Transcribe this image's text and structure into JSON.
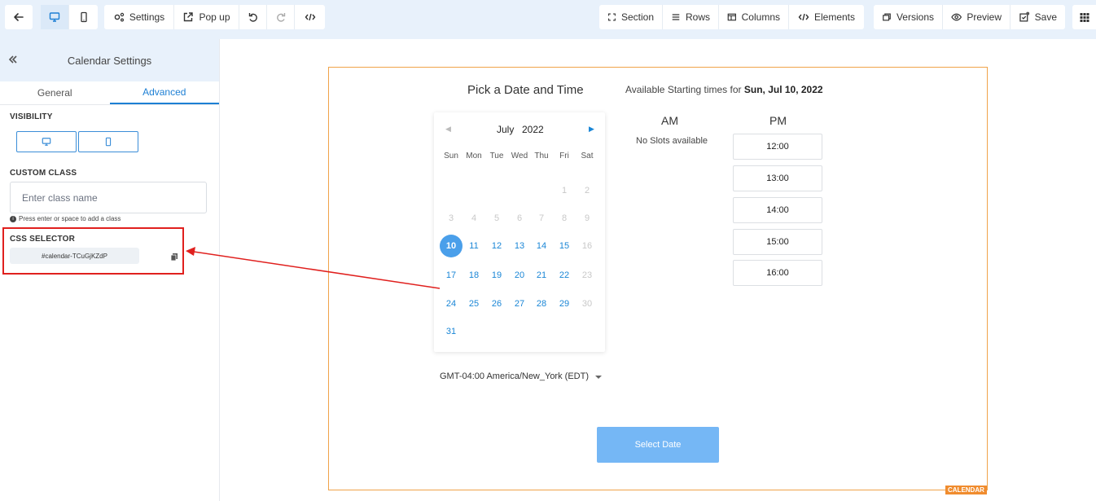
{
  "toolbar": {
    "settings_label": "Settings",
    "popup_label": "Pop up",
    "section_label": "Section",
    "rows_label": "Rows",
    "columns_label": "Columns",
    "elements_label": "Elements",
    "versions_label": "Versions",
    "preview_label": "Preview",
    "save_label": "Save"
  },
  "sidebar": {
    "title": "Calendar Settings",
    "tabs": [
      "General",
      "Advanced"
    ],
    "active_tab": "Advanced",
    "visibility_label": "VISIBILITY",
    "custom_class_label": "CUSTOM CLASS",
    "custom_class_placeholder": "Enter class name",
    "hint": "Press enter or space to add a class",
    "css_selector_label": "CSS SELECTOR",
    "css_selector_value": "#calendar-TCuGjKZdP"
  },
  "calendar": {
    "title": "Pick a Date and Time",
    "available_prefix": "Available Starting times for",
    "available_date": "Sun, Jul 10, 2022",
    "month": "July",
    "year": "2022",
    "weekdays": [
      "Sun",
      "Mon",
      "Tue",
      "Wed",
      "Thu",
      "Fri",
      "Sat"
    ],
    "weeks": [
      [
        "",
        "",
        "",
        "",
        "",
        "1",
        "2"
      ],
      [
        "3",
        "4",
        "5",
        "6",
        "7",
        "8",
        "9"
      ],
      [
        "10",
        "11",
        "12",
        "13",
        "14",
        "15",
        "16"
      ],
      [
        "17",
        "18",
        "19",
        "20",
        "21",
        "22",
        "23"
      ],
      [
        "24",
        "25",
        "26",
        "27",
        "28",
        "29",
        "30"
      ],
      [
        "31",
        "",
        "",
        "",
        "",
        "",
        ""
      ]
    ],
    "selected_day": "10",
    "enabled_days": [
      "10",
      "11",
      "12",
      "13",
      "14",
      "15",
      "17",
      "18",
      "19",
      "20",
      "21",
      "22",
      "24",
      "25",
      "26",
      "27",
      "28",
      "29",
      "31"
    ],
    "timezone": "GMT-04:00 America/New_York (EDT)",
    "am_label": "AM",
    "pm_label": "PM",
    "no_slots": "No Slots available",
    "pm_slots": [
      "12:00",
      "13:00",
      "14:00",
      "15:00",
      "16:00"
    ],
    "select_button": "Select Date",
    "element_tag": "CALENDAR"
  },
  "colors": {
    "accent": "#1d7fd4",
    "highlight": "#e0201e",
    "frame": "#f0a34a",
    "select_button": "#75b7f5"
  }
}
